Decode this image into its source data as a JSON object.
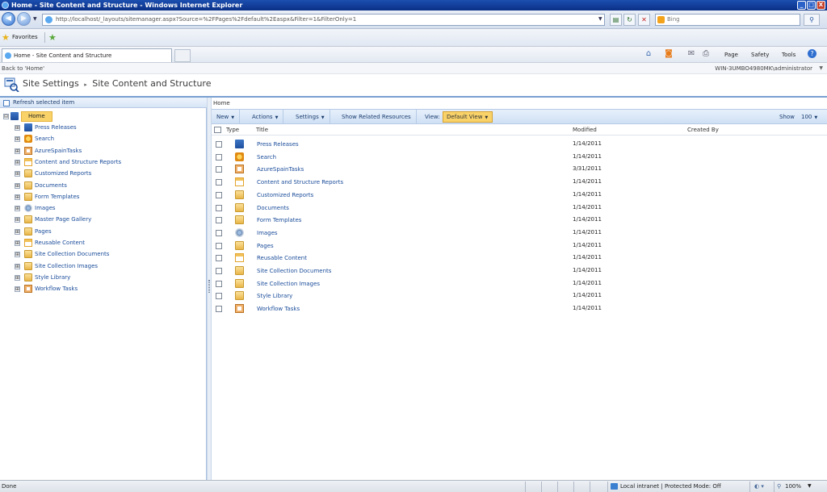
{
  "window": {
    "title": "Home - Site Content and Structure - Windows Internet Explorer",
    "buttons": [
      "_",
      "□",
      "X"
    ]
  },
  "browser": {
    "address": "http://localhost/_layouts/sitemanager.aspx?Source=%2FPages%2Fdefault%2Easpx&Filter=1&FilterOnly=1",
    "search_placeholder": "Bing",
    "favorites_label": "Favorites",
    "tab_title": "Home - Site Content and Structure",
    "commands": {
      "page": "Page",
      "safety": "Safety",
      "tools": "Tools"
    }
  },
  "sharepoint": {
    "back_link": "Back to 'Home'",
    "user": "WIN-3UMBO4980MK\\administrator",
    "breadcrumb_root": "Site Settings",
    "breadcrumb_sep": "▸",
    "page_title": "Site Content and Structure"
  },
  "tree": {
    "refresh_label": "Refresh selected item",
    "root": {
      "label": "Home",
      "expander": "⊟"
    },
    "items": [
      {
        "label": "Press Releases",
        "icon": "site-icon",
        "expander": "⊞"
      },
      {
        "label": "Search",
        "icon": "search-icon",
        "expander": "⊞"
      },
      {
        "label": "AzureSpainTasks",
        "icon": "task-list-icon",
        "expander": "⊞"
      },
      {
        "label": "Content and Structure Reports",
        "icon": "list-icon",
        "expander": "⊞"
      },
      {
        "label": "Customized Reports",
        "icon": "library-icon",
        "expander": "⊞"
      },
      {
        "label": "Documents",
        "icon": "library-icon",
        "expander": "⊞"
      },
      {
        "label": "Form Templates",
        "icon": "library-icon",
        "expander": "⊞"
      },
      {
        "label": "Images",
        "icon": "image-library-icon",
        "expander": "⊞"
      },
      {
        "label": "Master Page Gallery",
        "icon": "library-icon",
        "expander": "⊞"
      },
      {
        "label": "Pages",
        "icon": "library-icon",
        "expander": "⊞"
      },
      {
        "label": "Reusable Content",
        "icon": "list-icon",
        "expander": "⊞"
      },
      {
        "label": "Site Collection Documents",
        "icon": "library-icon",
        "expander": "⊞"
      },
      {
        "label": "Site Collection Images",
        "icon": "library-icon",
        "expander": "⊞"
      },
      {
        "label": "Style Library",
        "icon": "library-icon",
        "expander": "⊞"
      },
      {
        "label": "Workflow Tasks",
        "icon": "task-list-icon",
        "expander": "⊞"
      }
    ]
  },
  "content": {
    "breadcrumb": "Home",
    "toolbar": {
      "new": "New",
      "actions": "Actions",
      "settings": "Settings",
      "related": "Show Related Resources",
      "view_label": "View:",
      "view_value": "Default View",
      "show_label": "Show",
      "show_value": "100"
    },
    "columns": {
      "type": "Type",
      "title": "Title",
      "modified": "Modified",
      "created_by": "Created By"
    },
    "rows": [
      {
        "title": "Press Releases",
        "modified": "1/14/2011",
        "icon": "site-icon"
      },
      {
        "title": "Search",
        "modified": "1/14/2011",
        "icon": "search-icon"
      },
      {
        "title": "AzureSpainTasks",
        "modified": "3/31/2011",
        "icon": "task-list-icon"
      },
      {
        "title": "Content and Structure Reports",
        "modified": "1/14/2011",
        "icon": "list-icon"
      },
      {
        "title": "Customized Reports",
        "modified": "1/14/2011",
        "icon": "library-icon"
      },
      {
        "title": "Documents",
        "modified": "1/14/2011",
        "icon": "library-icon"
      },
      {
        "title": "Form Templates",
        "modified": "1/14/2011",
        "icon": "library-icon"
      },
      {
        "title": "Images",
        "modified": "1/14/2011",
        "icon": "image-library-icon"
      },
      {
        "title": "Pages",
        "modified": "1/14/2011",
        "icon": "library-icon"
      },
      {
        "title": "Reusable Content",
        "modified": "1/14/2011",
        "icon": "list-icon"
      },
      {
        "title": "Site Collection Documents",
        "modified": "1/14/2011",
        "icon": "library-icon"
      },
      {
        "title": "Site Collection Images",
        "modified": "1/14/2011",
        "icon": "library-icon"
      },
      {
        "title": "Style Library",
        "modified": "1/14/2011",
        "icon": "library-icon"
      },
      {
        "title": "Workflow Tasks",
        "modified": "1/14/2011",
        "icon": "task-list-icon"
      }
    ]
  },
  "status": {
    "left": "Done",
    "zone": "Local intranet | Protected Mode: Off",
    "zoom": "100%"
  },
  "colors": {
    "title_bar": "#0a2f86",
    "accent_highlight": "#f9d36a",
    "link": "#1a4c9a"
  }
}
